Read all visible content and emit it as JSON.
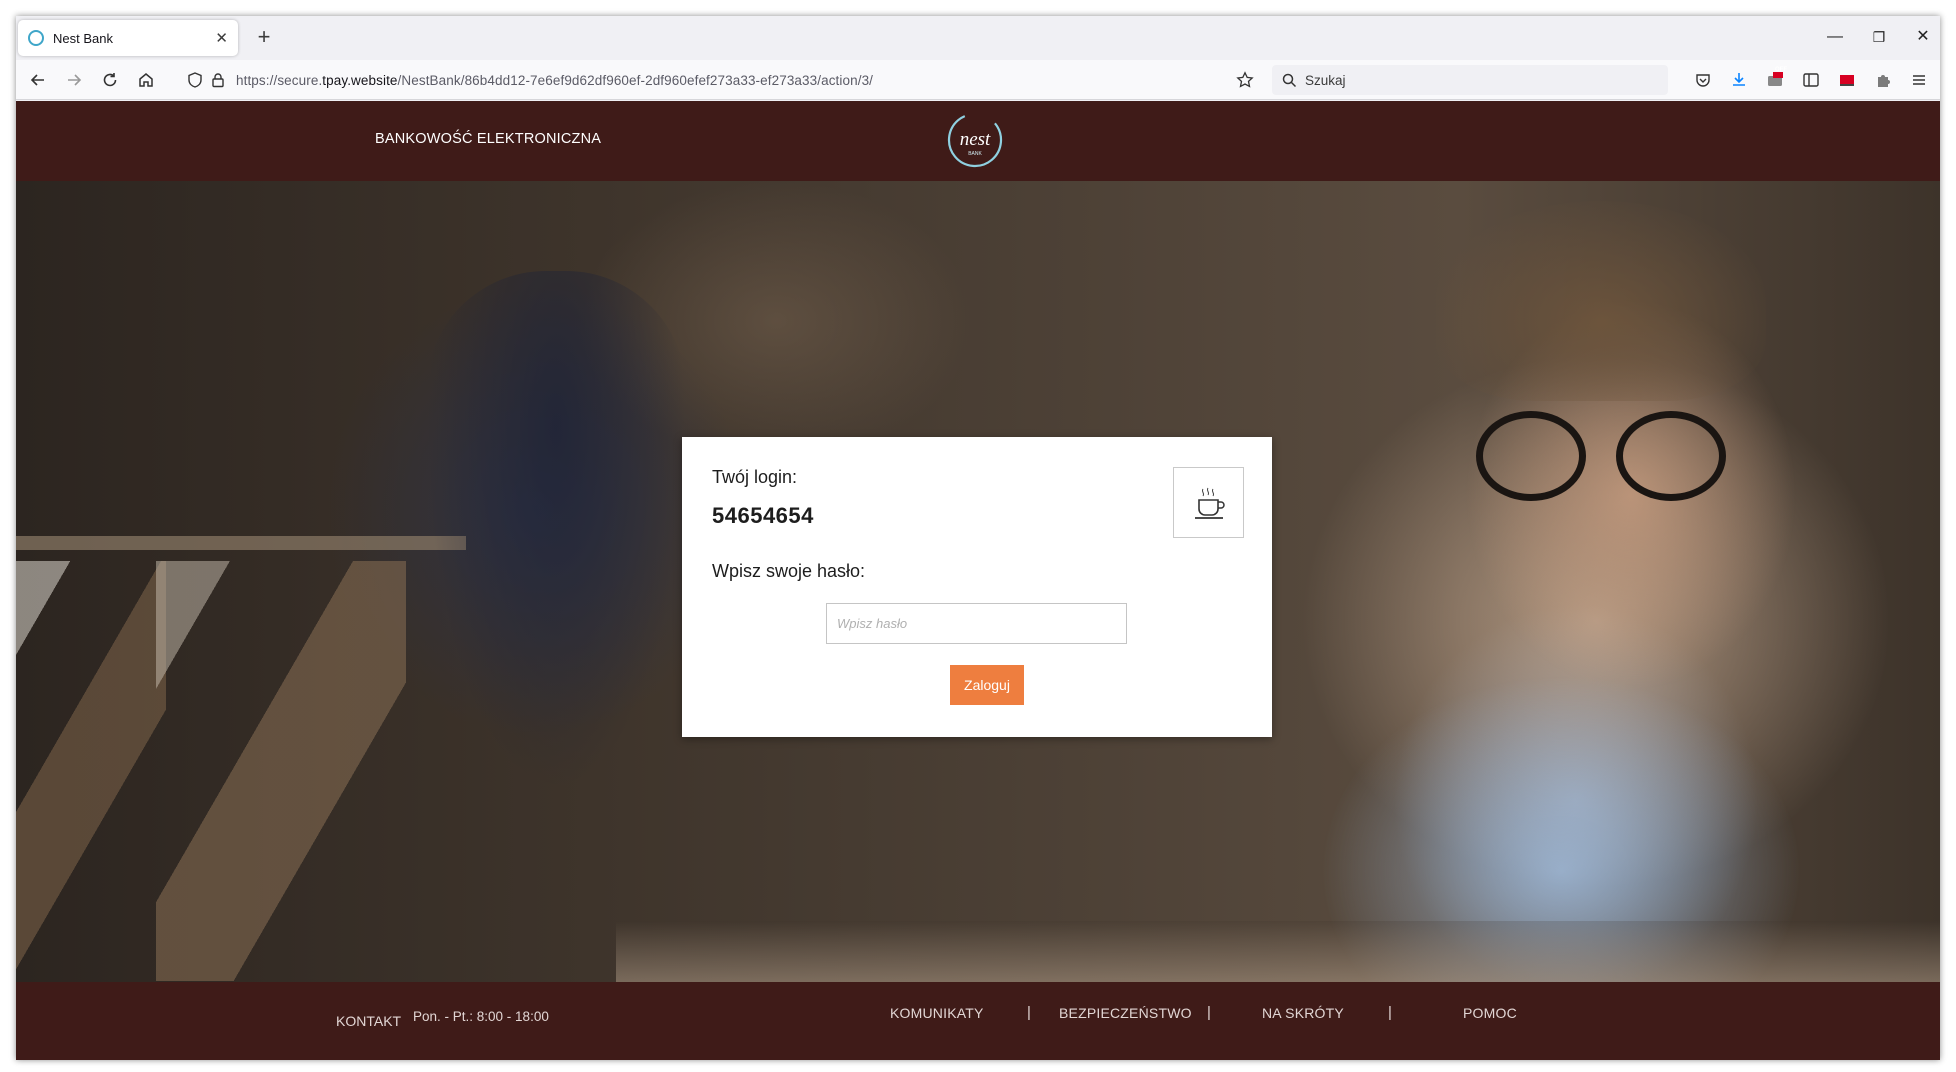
{
  "browser": {
    "tab_title": "Nest Bank",
    "url_prefix": "https://secure.",
    "url_domain": "tpay.website",
    "url_path": "/NestBank/86b4dd12-7e6ef9d62df960ef-2df960efef273a33-ef273a33/action/3/",
    "search_placeholder": "Szukaj",
    "extension_badge": "OFF"
  },
  "header": {
    "title": "BANKOWOŚĆ ELEKTRONICZNA",
    "logo_text": "nest",
    "logo_subtext": "BANK"
  },
  "login_form": {
    "login_label": "Twój login:",
    "login_value": "54654654",
    "password_label": "Wpisz swoje hasło:",
    "password_placeholder": "Wpisz hasło",
    "submit_label": "Zaloguj",
    "security_image": "coffee-cup-icon"
  },
  "footer": {
    "contact_label": "KONTAKT",
    "hours": "Pon. - Pt.: 8:00 - 18:00",
    "links": [
      "KOMUNIKATY",
      "BEZPIECZEŃSTWO",
      "NA SKRÓTY",
      "POMOC"
    ],
    "separator": "|"
  },
  "colors": {
    "brand_dark": "#3f1b18",
    "accent_orange": "#ee7e3f",
    "logo_teal": "#8fd0e0"
  }
}
